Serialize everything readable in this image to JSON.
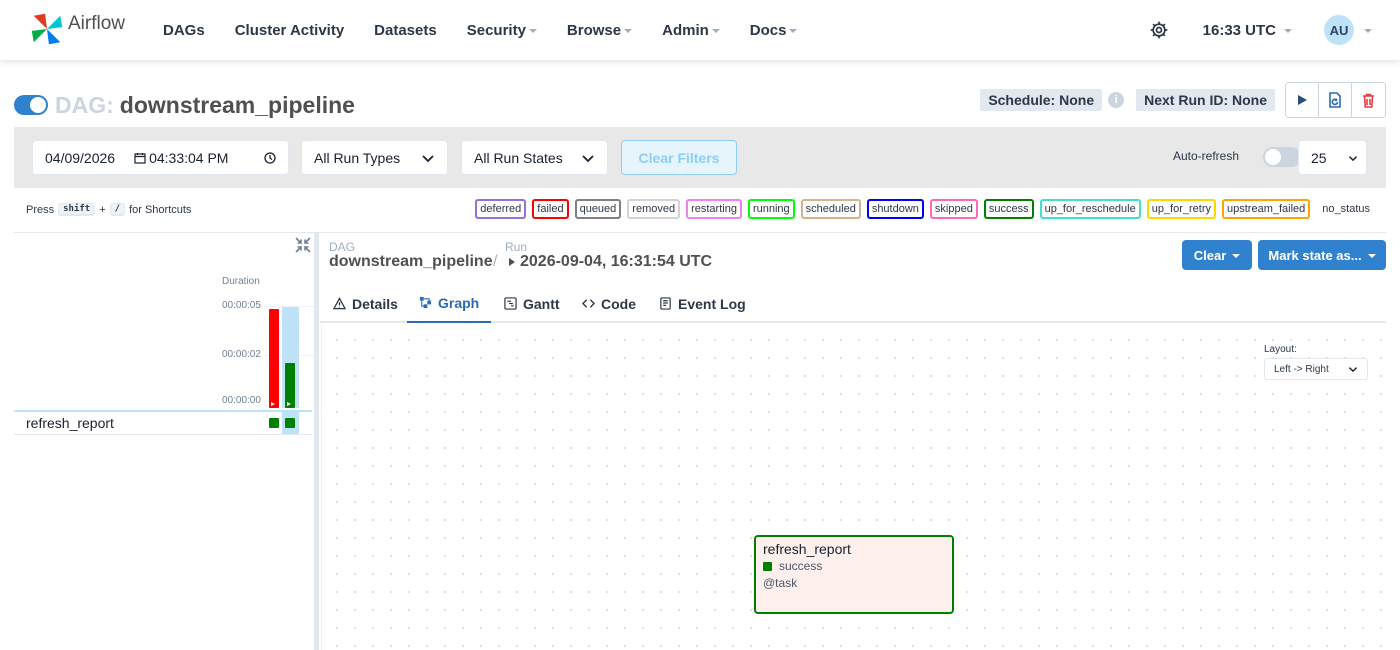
{
  "nav": {
    "brand": "Airflow",
    "items": [
      {
        "label": "DAGs",
        "dropdown": false
      },
      {
        "label": "Cluster Activity",
        "dropdown": false
      },
      {
        "label": "Datasets",
        "dropdown": false
      },
      {
        "label": "Security",
        "dropdown": true
      },
      {
        "label": "Browse",
        "dropdown": true
      },
      {
        "label": "Admin",
        "dropdown": true
      },
      {
        "label": "Docs",
        "dropdown": true
      }
    ],
    "time": "16:33 UTC",
    "user_initials": "AU"
  },
  "dag": {
    "prefix": "DAG:",
    "name": "downstream_pipeline",
    "schedule": "Schedule: None",
    "next_run": "Next Run ID: None"
  },
  "filters": {
    "date": "04/09/2026",
    "time": "04:33:04 PM",
    "run_types": "All Run Types",
    "run_states": "All Run States",
    "clear_filters": "Clear Filters",
    "auto_refresh": "Auto-refresh",
    "page_size": "25"
  },
  "shortcuts": {
    "press": "Press",
    "key1": "shift",
    "plus": "+",
    "key2": "/",
    "suffix": "for Shortcuts"
  },
  "legend": [
    {
      "label": "deferred",
      "color": "#9370db"
    },
    {
      "label": "failed",
      "color": "#ff0000"
    },
    {
      "label": "queued",
      "color": "#808080"
    },
    {
      "label": "removed",
      "color": "#d3d3d3"
    },
    {
      "label": "restarting",
      "color": "#ee82ee"
    },
    {
      "label": "running",
      "color": "#00ff00"
    },
    {
      "label": "scheduled",
      "color": "#d2b48c"
    },
    {
      "label": "shutdown",
      "color": "#0000ff"
    },
    {
      "label": "skipped",
      "color": "#ff69b4"
    },
    {
      "label": "success",
      "color": "#008000"
    },
    {
      "label": "up_for_reschedule",
      "color": "#40e0d0"
    },
    {
      "label": "up_for_retry",
      "color": "#ffd700"
    },
    {
      "label": "upstream_failed",
      "color": "#ffa500"
    },
    {
      "label": "no_status",
      "color": ""
    }
  ],
  "grid": {
    "duration_label": "Duration",
    "ticks": [
      "00:00:05",
      "00:00:02",
      "00:00:00"
    ],
    "runs": [
      {
        "state": "failed",
        "color": "#ff0000",
        "duration_fraction": 0.98
      },
      {
        "state": "success",
        "color": "#008000",
        "duration_fraction": 0.45
      }
    ],
    "task": "refresh_report"
  },
  "run": {
    "dag_label": "DAG",
    "dag_value": "downstream_pipeline",
    "sep": "/",
    "run_label": "Run",
    "run_value": "2026-09-04, 16:31:54 UTC",
    "clear_btn": "Clear",
    "mark_btn": "Mark state as..."
  },
  "tabs": [
    {
      "label": "Details",
      "icon": "warning-icon"
    },
    {
      "label": "Graph",
      "icon": "graph-icon",
      "active": true
    },
    {
      "label": "Gantt",
      "icon": "gantt-icon"
    },
    {
      "label": "Code",
      "icon": "code-icon"
    },
    {
      "label": "Event Log",
      "icon": "event-log-icon"
    }
  ],
  "graph": {
    "layout_label": "Layout:",
    "layout_value": "Left -> Right",
    "node": {
      "title": "refresh_report",
      "state": "success",
      "operator": "@task"
    }
  }
}
